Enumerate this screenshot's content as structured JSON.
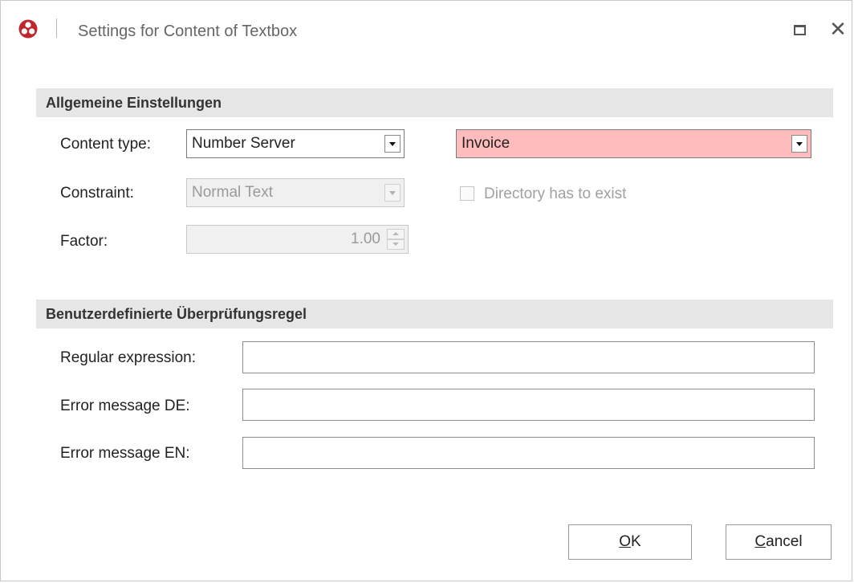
{
  "window": {
    "title": "Settings for Content of Textbox"
  },
  "sections": {
    "general": "Allgemeine Einstellungen",
    "custom": "Benutzerdefinierte Überprüfungsregel"
  },
  "fields": {
    "content_type": {
      "label": "Content type:",
      "value": "Number Server",
      "secondary_value": "Invoice"
    },
    "constraint": {
      "label": "Constraint:",
      "value": "Normal Text"
    },
    "factor": {
      "label": "Factor:",
      "value": "1.00"
    },
    "directory_check": {
      "label": "Directory has to exist",
      "checked": false
    },
    "regex": {
      "label": "Regular expression:",
      "value": ""
    },
    "error_de": {
      "label": "Error message DE:",
      "value": ""
    },
    "error_en": {
      "label": "Error message EN:",
      "value": ""
    }
  },
  "buttons": {
    "ok": {
      "accel": "O",
      "rest": "K"
    },
    "cancel": {
      "accel": "C",
      "rest": "ancel"
    }
  },
  "icons": {
    "app": "app-logo-icon",
    "maximize": "maximize-icon",
    "close": "close-icon"
  },
  "colors": {
    "invalid_field": "#ffbcbc",
    "logo": "#c0262d",
    "section_bg": "#e6e6e6"
  }
}
